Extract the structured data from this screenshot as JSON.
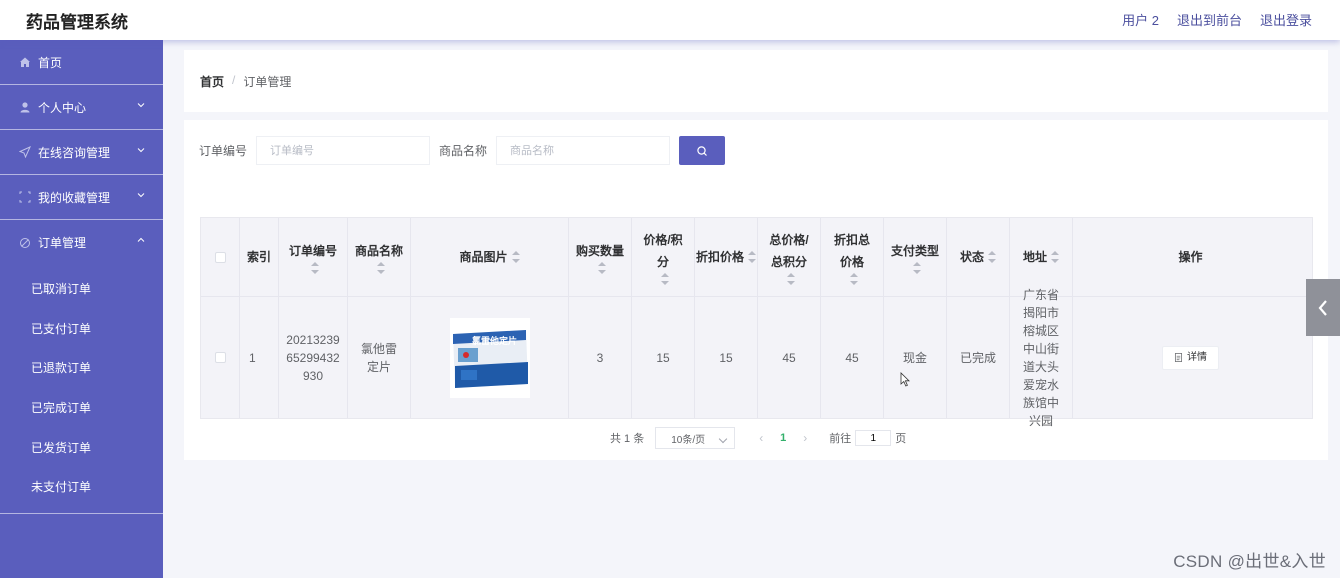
{
  "header": {
    "title": "药品管理系统",
    "actions": [
      "用户 2",
      "退出到前台",
      "退出登录"
    ]
  },
  "sidebar": {
    "items": [
      {
        "label": "首页",
        "icon": "home-icon"
      },
      {
        "label": "个人中心",
        "icon": "user-icon"
      },
      {
        "label": "在线咨询管理",
        "icon": "send-icon"
      },
      {
        "label": "我的收藏管理",
        "icon": "collection-icon"
      },
      {
        "label": "订单管理",
        "icon": "order-icon"
      }
    ],
    "order_sub": [
      "已取消订单",
      "已支付订单",
      "已退款订单",
      "已完成订单",
      "已发货订单",
      "未支付订单"
    ]
  },
  "breadcrumb": {
    "home": "首页",
    "sep": "/",
    "current": "订单管理"
  },
  "search": {
    "order_no_label": "订单编号",
    "order_no_placeholder": "订单编号",
    "product_label": "商品名称",
    "product_placeholder": "商品名称"
  },
  "table": {
    "headers": [
      "索引",
      "订单编号",
      "商品名称",
      "商品图片",
      "购买数量",
      "价格/积分",
      "折扣价格",
      "总价格/总积分",
      "折扣总价格",
      "支付类型",
      "状态",
      "地址",
      "操作"
    ],
    "rows": [
      {
        "index": "1",
        "order_no": "2021323965299432930",
        "product": "氯他雷定片",
        "image_caption": "氯雷他定片",
        "quantity": "3",
        "price": "15",
        "discount_price": "15",
        "total": "45",
        "discount_total": "45",
        "pay_type": "现金",
        "status": "已完成",
        "address": "广东省揭阳市榕城区中山街道大头爱宠水族馆中兴园",
        "action": "详情"
      }
    ]
  },
  "pagination": {
    "total": "共 1 条",
    "page_size": "10条/页",
    "current": "1",
    "goto_prefix": "前往",
    "goto_value": "1",
    "goto_suffix": "页"
  },
  "watermark": "CSDN @出世&入世",
  "colors": {
    "sidebar": "#5a5ebd",
    "accent": "#5a5ebd",
    "active_page": "#33b06b"
  }
}
